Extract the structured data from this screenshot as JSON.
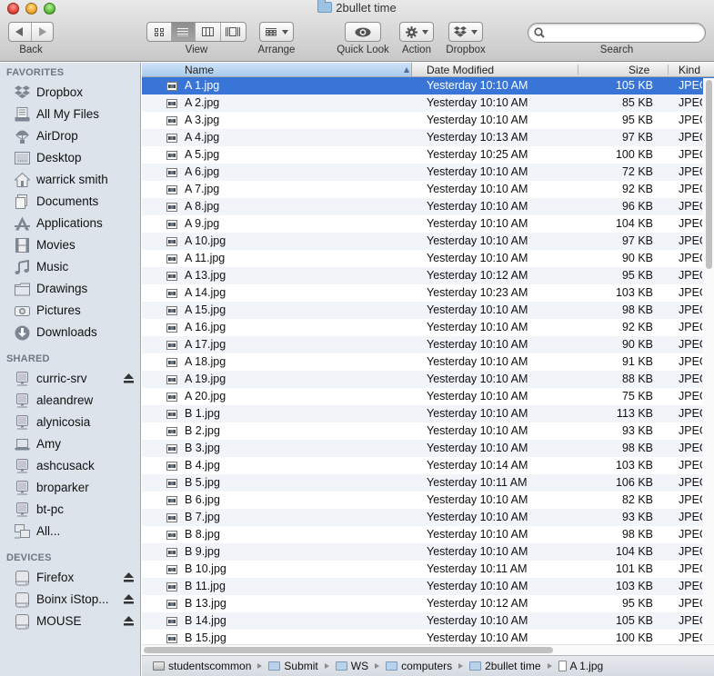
{
  "window": {
    "title": "2bullet time",
    "title_icon": "folder-icon"
  },
  "toolbar": {
    "back_label": "Back",
    "view_label": "View",
    "arrange_label": "Arrange",
    "quicklook_label": "Quick Look",
    "action_label": "Action",
    "dropbox_label": "Dropbox",
    "search_label": "Search",
    "search_value": "",
    "search_placeholder": "",
    "active_view": "list"
  },
  "sidebar": {
    "favorites_header": "FAVORITES",
    "favorites": [
      {
        "label": "Dropbox",
        "icon": "dropbox-icon"
      },
      {
        "label": "All My Files",
        "icon": "all-my-files-icon"
      },
      {
        "label": "AirDrop",
        "icon": "airdrop-icon"
      },
      {
        "label": "Desktop",
        "icon": "desktop-icon"
      },
      {
        "label": "warrick smith",
        "icon": "home-icon"
      },
      {
        "label": "Documents",
        "icon": "documents-icon"
      },
      {
        "label": "Applications",
        "icon": "applications-icon"
      },
      {
        "label": "Movies",
        "icon": "movies-icon"
      },
      {
        "label": "Music",
        "icon": "music-icon"
      },
      {
        "label": "Drawings",
        "icon": "folder-icon"
      },
      {
        "label": "Pictures",
        "icon": "pictures-icon"
      },
      {
        "label": "Downloads",
        "icon": "downloads-icon"
      }
    ],
    "shared_header": "SHARED",
    "shared": [
      {
        "label": "curric-srv",
        "icon": "server-icon",
        "eject": true
      },
      {
        "label": "aleandrew",
        "icon": "server-icon",
        "eject": false
      },
      {
        "label": "alynicosia",
        "icon": "server-icon",
        "eject": false
      },
      {
        "label": "Amy",
        "icon": "laptop-icon",
        "eject": false
      },
      {
        "label": "ashcusack",
        "icon": "server-icon",
        "eject": false
      },
      {
        "label": "broparker",
        "icon": "server-icon",
        "eject": false
      },
      {
        "label": "bt-pc",
        "icon": "server-icon",
        "eject": false
      },
      {
        "label": "All...",
        "icon": "network-icon",
        "eject": false
      }
    ],
    "devices_header": "DEVICES",
    "devices": [
      {
        "label": "Firefox",
        "icon": "drive-icon",
        "eject": true
      },
      {
        "label": "Boinx iStop...",
        "icon": "drive-icon",
        "eject": true
      },
      {
        "label": "MOUSE",
        "icon": "drive-icon",
        "eject": true
      }
    ]
  },
  "list": {
    "columns": {
      "name": "Name",
      "date": "Date Modified",
      "size": "Size",
      "kind": "Kind"
    },
    "sort_column": "name",
    "sort_direction": "ascending",
    "selected_index": 0,
    "rows": [
      {
        "name": "A 1.jpg",
        "date": "Yesterday 10:10 AM",
        "size": "105 KB",
        "kind": "JPEG"
      },
      {
        "name": "A 2.jpg",
        "date": "Yesterday 10:10 AM",
        "size": "85 KB",
        "kind": "JPEG"
      },
      {
        "name": "A 3.jpg",
        "date": "Yesterday 10:10 AM",
        "size": "95 KB",
        "kind": "JPEG"
      },
      {
        "name": "A 4.jpg",
        "date": "Yesterday 10:13 AM",
        "size": "97 KB",
        "kind": "JPEG"
      },
      {
        "name": "A 5.jpg",
        "date": "Yesterday 10:25 AM",
        "size": "100 KB",
        "kind": "JPEG"
      },
      {
        "name": "A 6.jpg",
        "date": "Yesterday 10:10 AM",
        "size": "72 KB",
        "kind": "JPEG"
      },
      {
        "name": "A 7.jpg",
        "date": "Yesterday 10:10 AM",
        "size": "92 KB",
        "kind": "JPEG"
      },
      {
        "name": "A 8.jpg",
        "date": "Yesterday 10:10 AM",
        "size": "96 KB",
        "kind": "JPEG"
      },
      {
        "name": "A 9.jpg",
        "date": "Yesterday 10:10 AM",
        "size": "104 KB",
        "kind": "JPEG"
      },
      {
        "name": "A 10.jpg",
        "date": "Yesterday 10:10 AM",
        "size": "97 KB",
        "kind": "JPEG"
      },
      {
        "name": "A 11.jpg",
        "date": "Yesterday 10:10 AM",
        "size": "90 KB",
        "kind": "JPEG"
      },
      {
        "name": "A 13.jpg",
        "date": "Yesterday 10:12 AM",
        "size": "95 KB",
        "kind": "JPEG"
      },
      {
        "name": "A 14.jpg",
        "date": "Yesterday 10:23 AM",
        "size": "103 KB",
        "kind": "JPEG"
      },
      {
        "name": "A 15.jpg",
        "date": "Yesterday 10:10 AM",
        "size": "98 KB",
        "kind": "JPEG"
      },
      {
        "name": "A 16.jpg",
        "date": "Yesterday 10:10 AM",
        "size": "92 KB",
        "kind": "JPEG"
      },
      {
        "name": "A 17.jpg",
        "date": "Yesterday 10:10 AM",
        "size": "90 KB",
        "kind": "JPEG"
      },
      {
        "name": "A 18.jpg",
        "date": "Yesterday 10:10 AM",
        "size": "91 KB",
        "kind": "JPEG"
      },
      {
        "name": "A 19.jpg",
        "date": "Yesterday 10:10 AM",
        "size": "88 KB",
        "kind": "JPEG"
      },
      {
        "name": "A 20.jpg",
        "date": "Yesterday 10:10 AM",
        "size": "75 KB",
        "kind": "JPEG"
      },
      {
        "name": "B 1.jpg",
        "date": "Yesterday 10:10 AM",
        "size": "113 KB",
        "kind": "JPEG"
      },
      {
        "name": "B 2.jpg",
        "date": "Yesterday 10:10 AM",
        "size": "93 KB",
        "kind": "JPEG"
      },
      {
        "name": "B 3.jpg",
        "date": "Yesterday 10:10 AM",
        "size": "98 KB",
        "kind": "JPEG"
      },
      {
        "name": "B 4.jpg",
        "date": "Yesterday 10:14 AM",
        "size": "103 KB",
        "kind": "JPEG"
      },
      {
        "name": "B 5.jpg",
        "date": "Yesterday 10:11 AM",
        "size": "106 KB",
        "kind": "JPEG"
      },
      {
        "name": "B 6.jpg",
        "date": "Yesterday 10:10 AM",
        "size": "82 KB",
        "kind": "JPEG"
      },
      {
        "name": "B 7.jpg",
        "date": "Yesterday 10:10 AM",
        "size": "93 KB",
        "kind": "JPEG"
      },
      {
        "name": "B 8.jpg",
        "date": "Yesterday 10:10 AM",
        "size": "98 KB",
        "kind": "JPEG"
      },
      {
        "name": "B 9.jpg",
        "date": "Yesterday 10:10 AM",
        "size": "104 KB",
        "kind": "JPEG"
      },
      {
        "name": "B 10.jpg",
        "date": "Yesterday 10:11 AM",
        "size": "101 KB",
        "kind": "JPEG"
      },
      {
        "name": "B 11.jpg",
        "date": "Yesterday 10:10 AM",
        "size": "103 KB",
        "kind": "JPEG"
      },
      {
        "name": "B 13.jpg",
        "date": "Yesterday 10:12 AM",
        "size": "95 KB",
        "kind": "JPEG"
      },
      {
        "name": "B 14.jpg",
        "date": "Yesterday 10:10 AM",
        "size": "105 KB",
        "kind": "JPEG"
      },
      {
        "name": "B 15.jpg",
        "date": "Yesterday 10:10 AM",
        "size": "100 KB",
        "kind": "JPEG"
      }
    ]
  },
  "pathbar": {
    "crumbs": [
      {
        "label": "studentscommon",
        "icon": "disk-icon"
      },
      {
        "label": "Submit",
        "icon": "folder-icon"
      },
      {
        "label": "WS",
        "icon": "folder-icon"
      },
      {
        "label": "computers",
        "icon": "folder-icon"
      },
      {
        "label": "2bullet time",
        "icon": "folder-icon"
      },
      {
        "label": "A 1.jpg",
        "icon": "jpeg-file-icon"
      }
    ]
  },
  "colors": {
    "selection": "#3875d7",
    "alt_row": "#f1f5fa",
    "sidebar_bg": "#dde3ea",
    "section_header": "#6c7884"
  }
}
